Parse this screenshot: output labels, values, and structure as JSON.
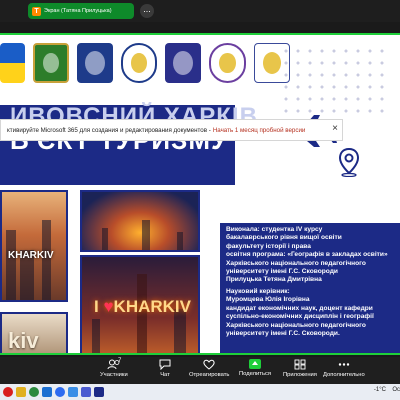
{
  "share_bar": {
    "icon_letter": "Т",
    "label": "Экран (Татяна Прилуцька)",
    "more_label": "..."
  },
  "ms_banner": {
    "text": "ктивируйте Microsoft 365 для создания и редактирования документов -",
    "link": "Начать 1 месяц пробной версии",
    "close": "×"
  },
  "slide": {
    "title_line1": "ИВОВСНИЙ ХАРКІВ",
    "title_line2": "Б'ЄКТ ТУРИЗМУ",
    "photo_labels": {
      "kharkiv_small": "KHARKIV",
      "kharkiv_heart_prefix": "I ",
      "kharkiv_heart": "♥",
      "kharkiv_heart_suffix": "KHARKIV",
      "kharkiv_letters": "kiv"
    },
    "author_box": [
      "Виконала: студентка ІV курсу",
      "бакалаврського рівня вищої освіти",
      "факультету історії і права",
      "освітня програма: «Географія в закладах освіти»",
      "Харківського національного педагогічного",
      "університету імені Г.С. Сковороди",
      "Прилуцька Тетяна Дмитрівна"
    ],
    "supervisor_box": [
      "Науковий керівник:",
      "Муромцева Юлія Ігорівна",
      "кандидат економічних наук,  доцент кафедри",
      "суспільно-економічних дисциплін і географії",
      "Харківського національного педагогічного",
      "університету імені Г.С. Сковороди."
    ]
  },
  "toolbar": {
    "participants_label": "Участники",
    "participants_count": "7",
    "chat_label": "Чат",
    "react_label": "Отреагировать",
    "share_label": "Поделиться",
    "apps_label": "Приложения",
    "more_label": "Дополнительно"
  },
  "taskbar": {
    "weather": "-1°C",
    "end_text": "Ос"
  },
  "colors": {
    "slide_blue": "#1c2a86",
    "share_green": "#0e8a2a",
    "border_green": "#1ecf3a",
    "ms_link": "#b5301f"
  }
}
